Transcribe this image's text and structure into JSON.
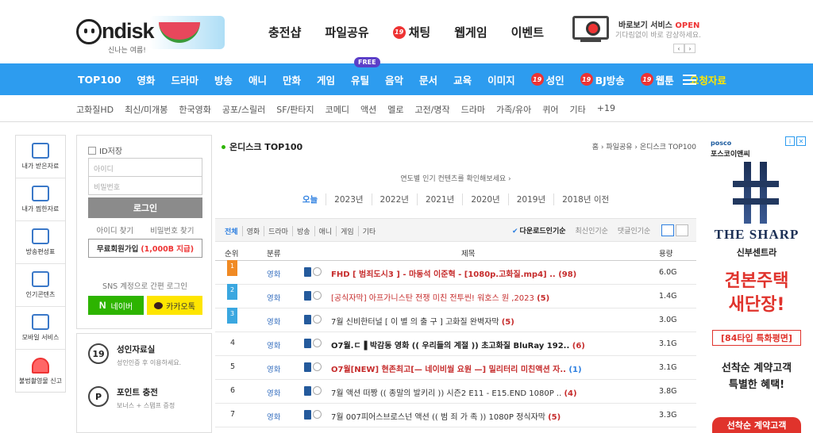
{
  "header": {
    "logo_text": "ndisk",
    "logo_sub": "신나는 여름!",
    "nav": [
      {
        "label": "충전샵",
        "badge": ""
      },
      {
        "label": "파일공유",
        "badge": ""
      },
      {
        "label": "채팅",
        "badge": "19"
      },
      {
        "label": "웹게임",
        "badge": ""
      },
      {
        "label": "이벤트",
        "badge": ""
      }
    ],
    "preview_title_a": "바로보기 서비스 ",
    "preview_title_b": "OPEN",
    "preview_sub": "기다림없이 바로 감상하세요.",
    "prev_arrow": "‹",
    "next_arrow": "›"
  },
  "mainnav": {
    "free_badge": "FREE",
    "items": [
      {
        "label": "TOP100",
        "badge": "",
        "state": "active"
      },
      {
        "label": "영화",
        "badge": "",
        "state": ""
      },
      {
        "label": "드라마",
        "badge": "",
        "state": ""
      },
      {
        "label": "방송",
        "badge": "",
        "state": ""
      },
      {
        "label": "애니",
        "badge": "",
        "state": ""
      },
      {
        "label": "만화",
        "badge": "",
        "state": ""
      },
      {
        "label": "게임",
        "badge": "",
        "state": ""
      },
      {
        "label": "유틸",
        "badge": "",
        "state": ""
      },
      {
        "label": "음악",
        "badge": "",
        "state": ""
      },
      {
        "label": "문서",
        "badge": "",
        "state": ""
      },
      {
        "label": "교육",
        "badge": "",
        "state": ""
      },
      {
        "label": "이미지",
        "badge": "",
        "state": ""
      },
      {
        "label": "성인",
        "badge": "19",
        "state": ""
      },
      {
        "label": "BJ방송",
        "badge": "19",
        "state": ""
      },
      {
        "label": "웹툰",
        "badge": "19",
        "state": ""
      },
      {
        "label": "요청자료",
        "badge": "",
        "state": "last"
      }
    ]
  },
  "subnav": [
    "고화질HD",
    "최신/미개봉",
    "한국영화",
    "공포/스릴러",
    "SF/판타지",
    "코메디",
    "액션",
    "멜로",
    "고전/명작",
    "드라마",
    "가족/유아",
    "퀴어",
    "기타",
    "+19"
  ],
  "sidebar": [
    {
      "label": "내가 받은자료",
      "icon": "download-icon"
    },
    {
      "label": "내가 찜한자료",
      "icon": "heart-hand-icon"
    },
    {
      "label": "방송편성표",
      "icon": "tv-icon"
    },
    {
      "label": "인기콘텐츠",
      "icon": "star-badge-icon"
    },
    {
      "label": "모바일 서비스",
      "icon": "mobile-icon"
    },
    {
      "label": "불법촬영물 신고",
      "icon": "siren-icon"
    }
  ],
  "login": {
    "remember": "ID저장",
    "id_placeholder": "아이디",
    "pw_placeholder": "비밀번호",
    "login_btn": "로그인",
    "find_id": "아이디 찾기",
    "find_pw": "비밀번호 찾기",
    "join_label": "무료회원가입",
    "join_bonus": "(1,000B 지급)",
    "sns_label": "SNS 계정으로 간편 로그인",
    "naver": "네이버",
    "kakao": "카카오톡"
  },
  "info": [
    {
      "title": "성인자료실",
      "desc": "성인인증 후 이용하세요.",
      "icon": "19"
    },
    {
      "title": "포인트 충전",
      "desc": "보너스 + 스탬프 증정",
      "icon": "P"
    }
  ],
  "main": {
    "title": "온디스크 TOP100",
    "breadcrumb": "홈 › 파일공유 › 온디스크 TOP100",
    "hint": "연도별 인기 컨텐츠를 확인해보세요 ›",
    "years": [
      "오늘",
      "2023년",
      "2022년",
      "2021년",
      "2020년",
      "2019년",
      "2018년 이전"
    ],
    "categories": [
      "전체",
      "영화",
      "드라마",
      "방송",
      "애니",
      "게임",
      "기타"
    ],
    "sorts": [
      "다운로드인기순",
      "최신인기순",
      "댓글인기순"
    ],
    "columns": {
      "rank": "순위",
      "category": "분류",
      "title": "제목",
      "size": "용량"
    },
    "rows": [
      {
        "rank": "1",
        "top": "r1",
        "cat": "영화",
        "title": "FHD [ 범죄도시3 ] - 마동석 이준혁 - [1080p.고화질.mp4] .. ",
        "count": "(98)",
        "size": "6.0G",
        "style": "redb",
        "cstyle": ""
      },
      {
        "rank": "2",
        "top": "r2",
        "cat": "영화",
        "title": "[공식자막] 아프가니스탄 전쟁 미친 전투씬! 워호스 원 ,2023 ",
        "count": "(5)",
        "size": "1.4G",
        "style": "red",
        "cstyle": ""
      },
      {
        "rank": "3",
        "top": "r3",
        "cat": "영화",
        "title": "7월 신비한터널 [ 이 별 의 출 구 ] 고화질 완벽자막 ",
        "count": "(5)",
        "size": "3.0G",
        "style": "",
        "cstyle": ""
      },
      {
        "rank": "4",
        "top": "",
        "cat": "영화",
        "title": "O7월.ㄷ▐ 박감동 영화 (( 우리들의 계절 )) 초고화질 BluRay 192.. ",
        "count": "(6)",
        "size": "3.1G",
        "style": "bold",
        "cstyle": ""
      },
      {
        "rank": "5",
        "top": "",
        "cat": "영화",
        "title": "O7월[NEW] 현존최고[— 네이비씰 요원 —] 밀리터리 미친액션 자.. ",
        "count": "(1)",
        "size": "3.1G",
        "style": "redb",
        "cstyle": "blue"
      },
      {
        "rank": "6",
        "top": "",
        "cat": "영화",
        "title": "7월 액션 떠짱 (( 종말의 발키리 )) 시즌2 E11 - E15.END 1080P .. ",
        "count": "(4)",
        "size": "3.8G",
        "style": "",
        "cstyle": ""
      },
      {
        "rank": "7",
        "top": "",
        "cat": "영화",
        "title": "7월 007피어스브로스넌 액션 (( 범 죄 가 족 )) 1080P 정식자막 ",
        "count": "(5)",
        "size": "3.3G",
        "style": "",
        "cstyle": ""
      }
    ]
  },
  "ad": {
    "brand": "posco",
    "brand2": "포스코이앤씨",
    "name": "THE SHARP",
    "name2": "신부센트라",
    "headline1": "견본주택",
    "headline2": "새단장!",
    "type": "[84타입 특화평면]",
    "small1": "선착순 계약고객",
    "small2": "특별한 혜택!",
    "btn": "선착순 계약고객",
    "info": "i",
    "close": "✕"
  },
  "colors": {
    "nav_bg": "#2d9cef",
    "accent_red": "#c62c2c",
    "active": "#ffe600",
    "naver": "#2db400",
    "kakao": "#fee500"
  }
}
